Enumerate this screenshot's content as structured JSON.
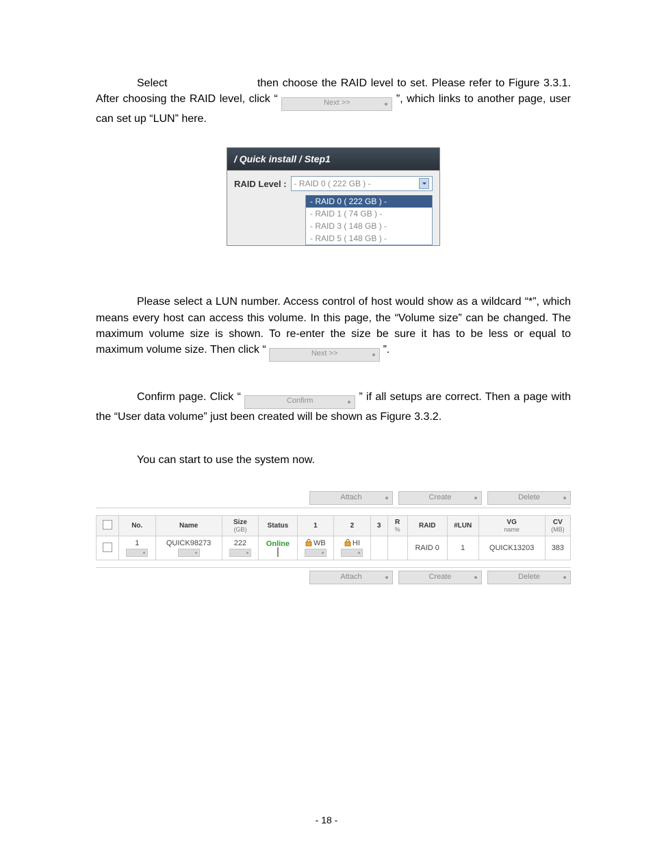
{
  "p1_a": "Select",
  "p1_b": "then choose the RAID level to set. Please refer to Figure 3.3.1. After choosing the RAID level, click “",
  "p1_c": "”, which links to another page, user can set up “LUN” here.",
  "btn_next": "Next >>",
  "btn_confirm": "Confirm",
  "panel": {
    "title": "/ Quick install / Step1",
    "raid_label": "RAID Level :",
    "selected": "- RAID 0 ( 222 GB ) -",
    "options": [
      "- RAID 0 ( 222 GB ) -",
      "- RAID 1 ( 74 GB ) -",
      "- RAID 3 ( 148 GB ) -",
      "- RAID 5 ( 148 GB ) -"
    ]
  },
  "p2": "Please select a LUN number. Access control of host would show as a wildcard “*”, which means every host can access this volume. In this page, the “Volume size” can be changed.  The maximum volume size is shown. To re-enter the size be sure it has to be less or equal to maximum volume size. Then click “",
  "p2_end": "”.",
  "p3_a": "Confirm page. Click “",
  "p3_b": "” if all setups are correct. Then a page with the “User data volume” just been created will be shown as Figure 3.3.2.",
  "p4": "You can start to use the system now.",
  "actions": {
    "attach": "Attach",
    "create": "Create",
    "delete": "Delete"
  },
  "thead": {
    "no": "No.",
    "name": "Name",
    "size": "Size",
    "size_sub": "(GB)",
    "status": "Status",
    "c1": "1",
    "c2": "2",
    "c3": "3",
    "r": "R",
    "r_sub": "%",
    "raid": "RAID",
    "lun": "#LUN",
    "vg": "VG",
    "vg_sub": "name",
    "cv": "CV",
    "cv_sub": "(MB)"
  },
  "row": {
    "no": "1",
    "name": "QUICK98273",
    "size": "222",
    "status": "Online",
    "c1": "WB",
    "c2": "HI",
    "c3": "",
    "r": "",
    "raid": "RAID 0",
    "lun": "1",
    "vg": "QUICK13203",
    "cv": "383"
  },
  "page_num": "- 18 -"
}
